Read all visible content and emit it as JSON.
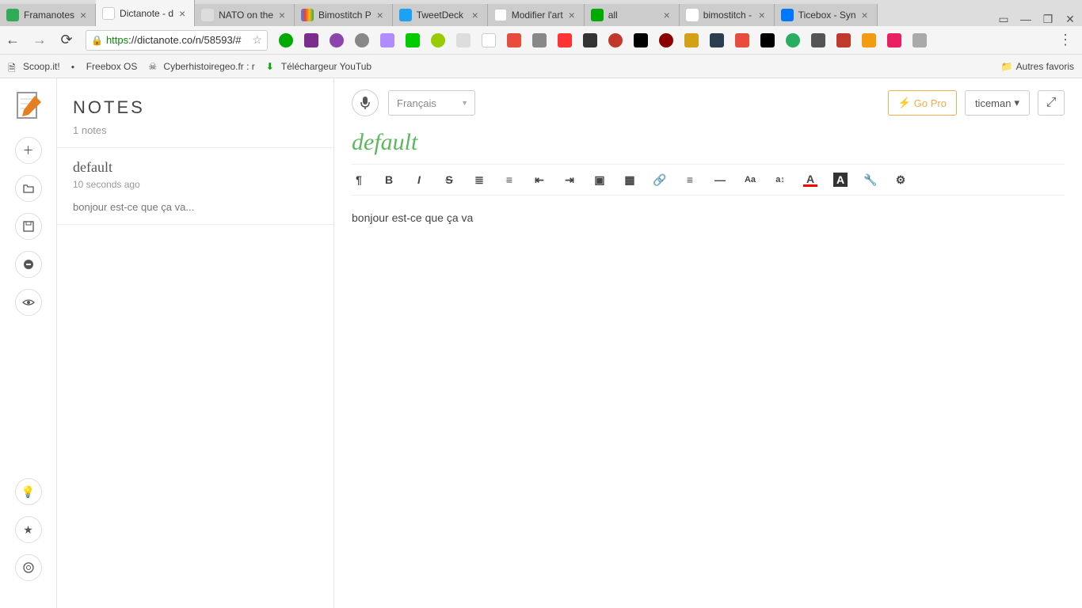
{
  "browser": {
    "tabs": [
      {
        "label": "Framanotes"
      },
      {
        "label": "Dictanote - d"
      },
      {
        "label": "NATO on the"
      },
      {
        "label": "Bimostitch P"
      },
      {
        "label": "TweetDeck"
      },
      {
        "label": "Modifier l'art"
      },
      {
        "label": "all"
      },
      {
        "label": "bimostitch -"
      },
      {
        "label": "Ticebox - Syn"
      }
    ],
    "active_tab_index": 1,
    "url_protocol": "https",
    "url_rest": "://dictanote.co/n/58593/#",
    "bookmarks": [
      {
        "label": "Scoop.it!"
      },
      {
        "label": "Freebox OS"
      },
      {
        "label": "Cyberhistoiregeo.fr : r"
      },
      {
        "label": "Téléchargeur YouTub"
      }
    ],
    "other_bookmarks_label": "Autres favoris"
  },
  "list": {
    "header": "NOTES",
    "count_text": "1 notes",
    "items": [
      {
        "title": "default",
        "time": "10 seconds ago",
        "preview": "bonjour est-ce que ça va..."
      }
    ]
  },
  "editor": {
    "language": "Français",
    "gopro_label": "Go Pro",
    "user_label": "ticeman",
    "title": "default",
    "body": "bonjour est-ce que ça va",
    "tools": {
      "paragraph": "¶",
      "bold": "B",
      "italic": "I",
      "strike": "S",
      "ul": "≣",
      "ol": "≡",
      "indent_out": "⇤",
      "indent_in": "⇥",
      "image": "▣",
      "table": "▦",
      "link": "🔗",
      "align": "≡",
      "hr": "—",
      "font": "Aa",
      "size": "a↕",
      "color": "A",
      "bg": "A",
      "tools_icon": "🔧",
      "settings": "⚙"
    }
  }
}
